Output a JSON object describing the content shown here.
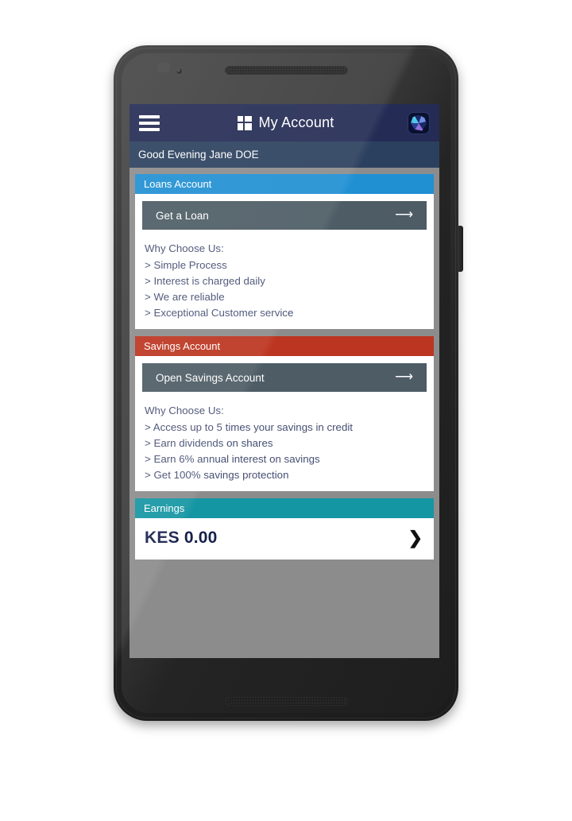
{
  "appbar": {
    "menu_icon": "hamburger-menu-icon",
    "grid_icon": "grid-dashboard-icon",
    "title": "My Account",
    "logo_icon": "brand-logo-icon"
  },
  "greeting": {
    "text": "Good Evening Jane DOE"
  },
  "colors": {
    "appbar": "#242b54",
    "greeting_bar": "#2b405e",
    "loans_header": "#2090d3",
    "savings_header": "#bc3520",
    "earnings_header": "#1596a3",
    "action_button": "#4d5c65",
    "screen_background": "#8c8c8c",
    "body_text": "#464f73",
    "amount_text": "#16204a"
  },
  "cards": {
    "loans": {
      "header": "Loans Account",
      "button_label": "Get a Loan",
      "button_arrow": "arrow-right-icon",
      "why_title": "Why Choose Us:",
      "why_items": [
        "> Simple Process",
        "> Interest is charged daily",
        "> We are reliable",
        "> Exceptional Customer service"
      ]
    },
    "savings": {
      "header": "Savings Account",
      "button_label": "Open Savings Account",
      "button_arrow": "arrow-right-icon",
      "why_title": "Why Choose Us:",
      "why_items": [
        "> Access up to 5 times your savings in credit",
        "> Earn dividends on shares",
        "> Earn 6% annual interest on savings",
        "> Get 100% savings protection"
      ]
    },
    "earnings": {
      "header": "Earnings",
      "amount": "KES 0.00",
      "chevron": "chevron-right-icon"
    }
  }
}
